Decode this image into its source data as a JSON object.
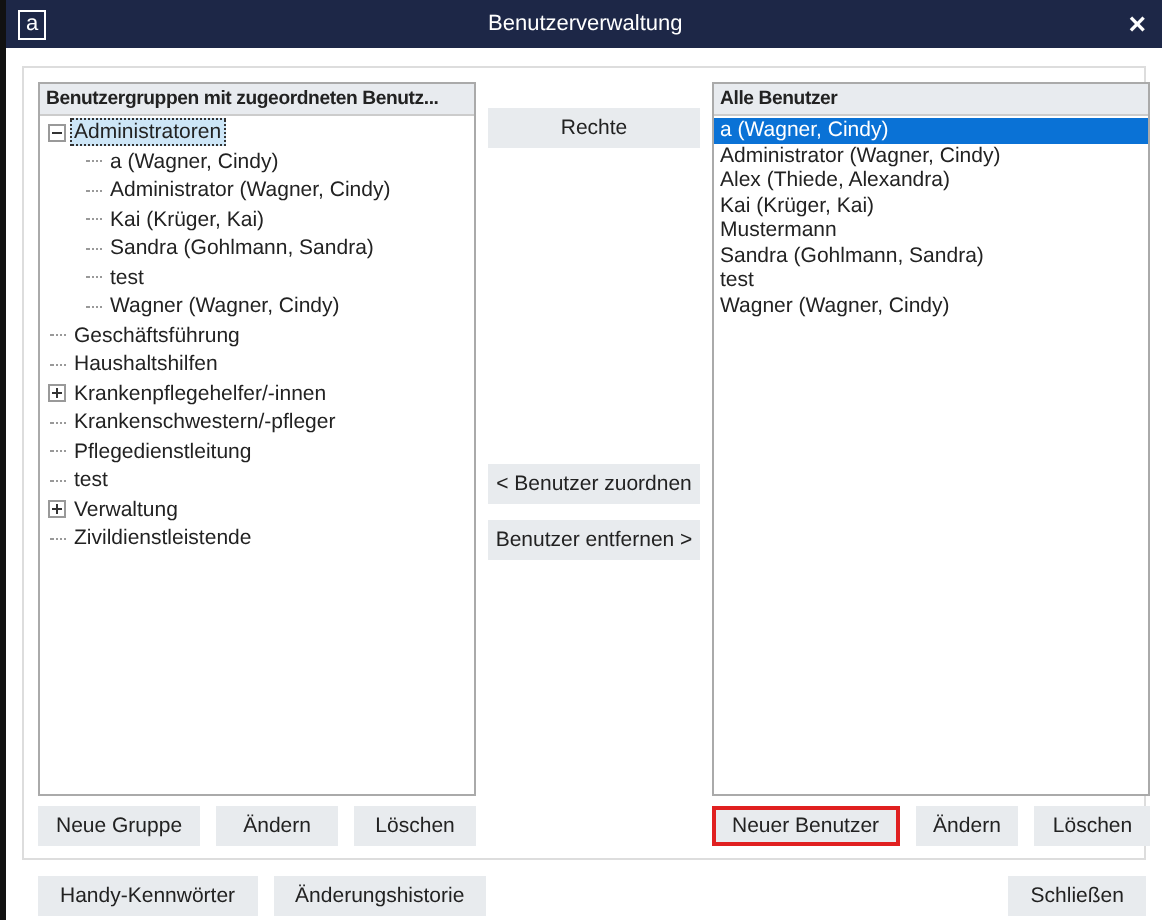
{
  "window": {
    "logo": "a",
    "title": "Benutzerverwaltung",
    "close": "×"
  },
  "groups_panel": {
    "header": "Benutzergruppen mit zugeordneten Benutz...",
    "tree": [
      {
        "label": "Administratoren",
        "expanded": true,
        "selected": true,
        "children": [
          {
            "label": "a  (Wagner, Cindy)",
            "selected": false
          },
          {
            "label": "Administrator  (Wagner, Cindy)",
            "selected": false
          },
          {
            "label": "Kai  (Krüger, Kai)",
            "selected": false
          },
          {
            "label": "Sandra  (Gohlmann, Sandra)",
            "selected": false
          },
          {
            "label": "test",
            "selected": false
          },
          {
            "label": "Wagner  (Wagner, Cindy)",
            "selected": false
          }
        ]
      },
      {
        "label": "Geschäftsführung",
        "selected": false
      },
      {
        "label": "Haushaltshilfen",
        "selected": false
      },
      {
        "label": "Krankenpflegehelfer/-innen",
        "expanded": false,
        "selected": false
      },
      {
        "label": "Krankenschwestern/-pfleger",
        "selected": false
      },
      {
        "label": "Pflegedienstleitung",
        "selected": false
      },
      {
        "label": "test",
        "selected": false
      },
      {
        "label": "Verwaltung",
        "expanded": false,
        "selected": false
      },
      {
        "label": "Zivildienstleistende",
        "selected": false
      }
    ],
    "buttons": [
      {
        "label": "Neue Gruppe",
        "highlighted": false
      },
      {
        "label": "Ändern",
        "highlighted": false
      },
      {
        "label": "Löschen",
        "highlighted": false
      }
    ]
  },
  "middle_buttons": {
    "top": "Rechte",
    "assign": "< Benutzer zuordnen",
    "remove": "Benutzer entfernen >"
  },
  "users_panel": {
    "header": "Alle Benutzer",
    "users": [
      {
        "label": "a  (Wagner, Cindy)",
        "selected": true
      },
      {
        "label": "Administrator  (Wagner, Cindy)",
        "selected": false
      },
      {
        "label": "Alex  (Thiede, Alexandra)",
        "selected": false
      },
      {
        "label": "Kai  (Krüger, Kai)",
        "selected": false
      },
      {
        "label": "Mustermann",
        "selected": false
      },
      {
        "label": "Sandra  (Gohlmann, Sandra)",
        "selected": false
      },
      {
        "label": "test",
        "selected": false
      },
      {
        "label": "Wagner  (Wagner, Cindy)",
        "selected": false
      }
    ],
    "buttons": [
      {
        "label": "Neuer Benutzer",
        "highlighted": true
      },
      {
        "label": "Ändern",
        "highlighted": false
      },
      {
        "label": "Löschen",
        "highlighted": false
      }
    ]
  },
  "footer": {
    "left_buttons": [
      "Handy-Kennwörter",
      "Änderungshistorie"
    ],
    "right_button": "Schließen"
  }
}
